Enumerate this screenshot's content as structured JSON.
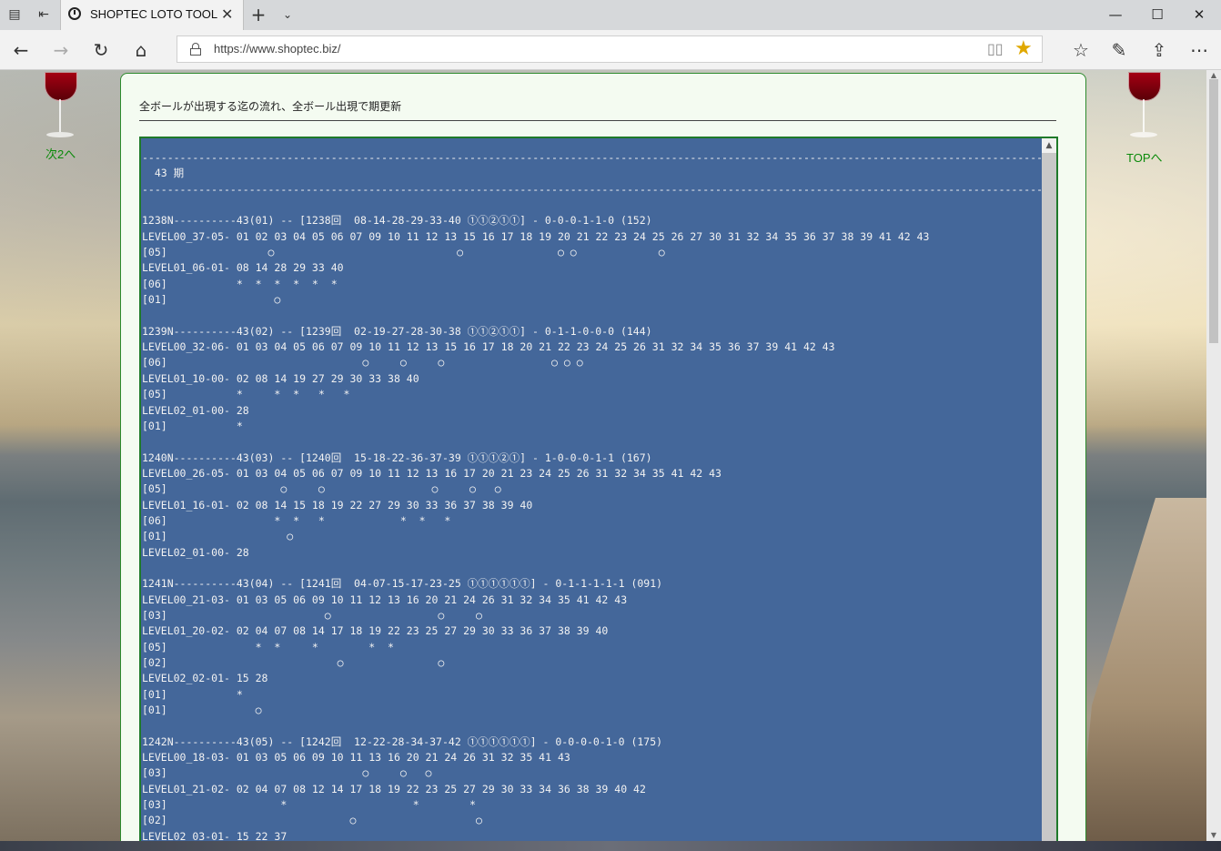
{
  "browser": {
    "tab_title": "SHOPTEC LOTO TOOL",
    "url": "https://www.shoptec.biz/",
    "icons": [
      "tab-list-icon",
      "set-aside-icon",
      "clock-icon",
      "close-icon",
      "new-tab-icon",
      "chevron-down-icon",
      "back-icon",
      "forward-icon",
      "refresh-icon",
      "home-icon",
      "lock-icon",
      "reading-view-icon",
      "star-icon",
      "favorites-icon",
      "pen-icon",
      "share-icon",
      "more-icon",
      "minimize-icon",
      "maximize-icon",
      "window-close-icon"
    ]
  },
  "page": {
    "left_link": "次2へ",
    "right_link": "TOPへ",
    "heading": "全ボールが出現する迄の流れ、全ボール出現で期更新",
    "data_lines": [
      "-------------------------------------------------------------------------------------------------------------------------------------------------------------------",
      "  43 期",
      "-------------------------------------------------------------------------------------------------------------------------------------------------------------------",
      "",
      "1238N----------43(01) -- [1238回  08-14-28-29-33-40 ①①②①①] - 0-0-0-1-1-0 (152)",
      "LEVEL00_37-05- 01 02 03 04 05 06 07 09 10 11 12 13 15 16 17 18 19 20 21 22 23 24 25 26 27 30 31 32 34 35 36 37 38 39 41 42 43",
      "[05]                ○                             ○               ○ ○             ○",
      "LEVEL01_06-01- 08 14 28 29 33 40",
      "[06]           *  *  *  *  *  *",
      "[01]                 ○",
      "",
      "1239N----------43(02) -- [1239回  02-19-27-28-30-38 ①①②①①] - 0-1-1-0-0-0 (144)",
      "LEVEL00_32-06- 01 03 04 05 06 07 09 10 11 12 13 15 16 17 18 20 21 22 23 24 25 26 31 32 34 35 36 37 39 41 42 43",
      "[06]                               ○     ○     ○                 ○ ○ ○",
      "LEVEL01_10-00- 02 08 14 19 27 29 30 33 38 40",
      "[05]           *     *  *   *   *",
      "LEVEL02_01-00- 28",
      "[01]           *",
      "",
      "1240N----------43(03) -- [1240回  15-18-22-36-37-39 ①①①②①] - 1-0-0-0-1-1 (167)",
      "LEVEL00_26-05- 01 03 04 05 06 07 09 10 11 12 13 16 17 20 21 23 24 25 26 31 32 34 35 41 42 43",
      "[05]                  ○     ○                 ○     ○   ○",
      "LEVEL01_16-01- 02 08 14 15 18 19 22 27 29 30 33 36 37 38 39 40",
      "[06]                 *  *   *            *  *   *",
      "[01]                   ○",
      "LEVEL02_01-00- 28",
      "",
      "1241N----------43(04) -- [1241回  04-07-15-17-23-25 ①①①①①①] - 0-1-1-1-1-1 (091)",
      "LEVEL00_21-03- 01 03 05 06 09 10 11 12 13 16 20 21 24 26 31 32 34 35 41 42 43",
      "[03]                         ○                 ○     ○",
      "LEVEL01_20-02- 02 04 07 08 14 17 18 19 22 23 25 27 29 30 33 36 37 38 39 40",
      "[05]              *  *     *        *  *",
      "[02]                           ○               ○",
      "LEVEL02_02-01- 15 28",
      "[01]           *",
      "[01]              ○",
      "",
      "1242N----------43(05) -- [1242回  12-22-28-34-37-42 ①①①①①①] - 0-0-0-0-1-0 (175)",
      "LEVEL00_18-03- 01 03 05 06 09 10 11 13 16 20 21 24 26 31 32 35 41 43",
      "[03]                               ○     ○   ○",
      "LEVEL01_21-02- 02 04 07 08 12 14 17 18 19 22 23 25 27 29 30 33 34 36 38 39 40 42",
      "[03]                  *                    *        *",
      "[02]                             ○                   ○",
      "LEVEL02_03-01- 15 22 37"
    ]
  }
}
